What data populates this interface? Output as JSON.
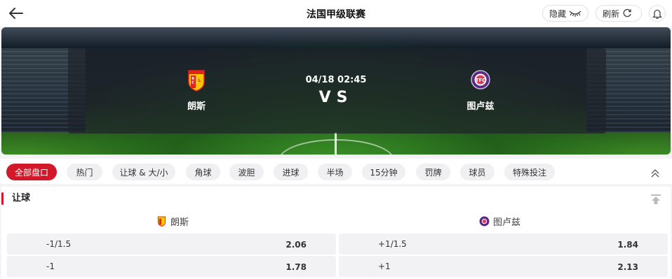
{
  "header": {
    "title": "法国甲级联赛",
    "hide_label": "隐藏",
    "refresh_label": "刷新"
  },
  "match": {
    "datetime": "04/18 02:45",
    "vs": "VS",
    "home": {
      "name": "朗斯"
    },
    "away": {
      "name": "图卢兹"
    }
  },
  "tabs": [
    {
      "label": "全部盘口",
      "active": true
    },
    {
      "label": "热门"
    },
    {
      "label": "让球 & 大/小"
    },
    {
      "label": "角球"
    },
    {
      "label": "波胆"
    },
    {
      "label": "进球"
    },
    {
      "label": "半场"
    },
    {
      "label": "15分钟"
    },
    {
      "label": "罚牌"
    },
    {
      "label": "球员"
    },
    {
      "label": "特殊投注"
    }
  ],
  "market": {
    "title": "让球",
    "home_header": "朗斯",
    "away_header": "图卢兹",
    "rows": [
      {
        "home_line": "-1/1.5",
        "home_price": "2.06",
        "away_line": "+1/1.5",
        "away_price": "1.84"
      },
      {
        "home_line": "-1",
        "home_price": "1.78",
        "away_line": "+1",
        "away_price": "2.13"
      }
    ]
  },
  "colors": {
    "accent": "#d2182b",
    "lens_crest": "#e2231a",
    "lens_gold": "#f7c600",
    "toulouse_crest": "#5a2a82"
  }
}
